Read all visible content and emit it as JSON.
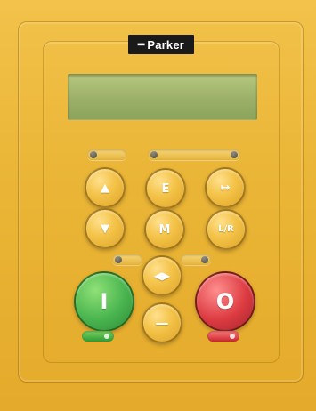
{
  "brand": {
    "name": "Parker",
    "mark": "━"
  },
  "colors": {
    "body": "#eab536",
    "lcd": "#9caf69",
    "start": "#49b44f",
    "stop": "#dc3b41",
    "logo_bg": "#1a1a1a"
  },
  "controls": {
    "up": "▲",
    "down": "▼",
    "enter": "E",
    "menu": "M",
    "forward": "↦",
    "local_remote": "L/R",
    "direction": "◀▶",
    "jog": "—",
    "start": "I",
    "stop": "O"
  }
}
